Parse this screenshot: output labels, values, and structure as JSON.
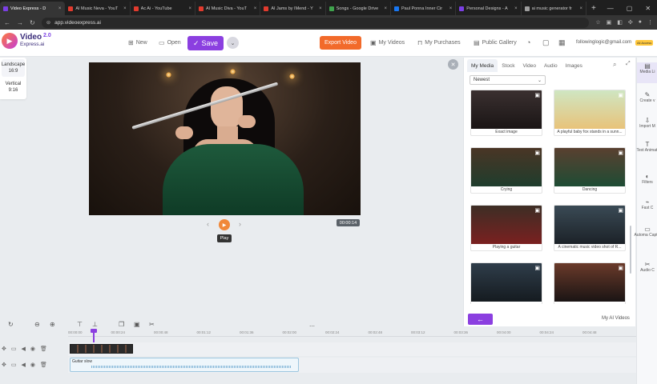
{
  "browser": {
    "tabs": [
      {
        "label": "Video Express - D",
        "color": "#7b3fe4",
        "active": true
      },
      {
        "label": "AI Music Neva - YouT",
        "color": "#e23b2e"
      },
      {
        "label": "Ac Ai - YouTube",
        "color": "#e23b2e"
      },
      {
        "label": "AI Music Diva - YouT",
        "color": "#e23b2e"
      },
      {
        "label": "AI Jams by IMend - Y",
        "color": "#e23b2e"
      },
      {
        "label": "Songs - Google Drive",
        "color": "#3fa34d"
      },
      {
        "label": "Paul Ponna Inner Cir",
        "color": "#1877f2"
      },
      {
        "label": "Personal Designs - A",
        "color": "#7b3fe4"
      },
      {
        "label": "ai music generator fr",
        "color": "#9e9e9e"
      }
    ],
    "url": "app.videoexpress.ai"
  },
  "header": {
    "logo_name": "Video",
    "logo_sub": "Express.ai",
    "logo_version": "2.0",
    "new_label": "New",
    "open_label": "Open",
    "save_label": "Save",
    "export_label": "Export Video",
    "my_videos_label": "My Videos",
    "my_purchases_label": "My Purchases",
    "public_gallery_label": "Public Gallery",
    "email": "followinglogic@gmail.com",
    "account_badge": "All Access"
  },
  "aspect": {
    "landscape_label": "Landscape",
    "landscape_ratio": "16:9",
    "vertical_label": "Vertical",
    "vertical_ratio": "9:16"
  },
  "preview": {
    "play_tooltip": "Play",
    "time": "00:00:14"
  },
  "media": {
    "tabs": [
      "My Media",
      "Stock",
      "Video",
      "Audio",
      "Images"
    ],
    "sort_value": "Newest",
    "items": [
      {
        "caption": "Exact image"
      },
      {
        "caption": "A playful baby fox stands in a sunn..."
      },
      {
        "caption": "Crying"
      },
      {
        "caption": "Dancing"
      },
      {
        "caption": "Playing a guitar"
      },
      {
        "caption": "A cinematic music video shot of R..."
      },
      {
        "caption": ""
      },
      {
        "caption": ""
      }
    ],
    "back_label": "←",
    "my_ai_videos_label": "My AI Videos"
  },
  "right_toolbar": [
    {
      "label": "Media Li",
      "icon": "media-library-icon"
    },
    {
      "label": "Create v",
      "icon": "create-icon"
    },
    {
      "label": "Import M",
      "icon": "import-icon"
    },
    {
      "label": "Text Animati",
      "icon": "text-icon"
    },
    {
      "label": "Filters",
      "icon": "filter-icon"
    },
    {
      "label": "Fast C",
      "icon": "fast-cut-icon"
    },
    {
      "label": "Automa Captio",
      "icon": "captions-icon"
    },
    {
      "label": "Audio C",
      "icon": "audio-cut-icon"
    }
  ],
  "timeline": {
    "ticks": [
      "00:00:00",
      "00:00:24",
      "00:00:48",
      "00:01:12",
      "00:01:36",
      "00:02:00",
      "00:02:24",
      "00:02:48",
      "00:03:12",
      "00:03:36",
      "00:04:00",
      "00:04:24",
      "00:04:48"
    ],
    "audio_clip_label": "Guitar slow"
  }
}
